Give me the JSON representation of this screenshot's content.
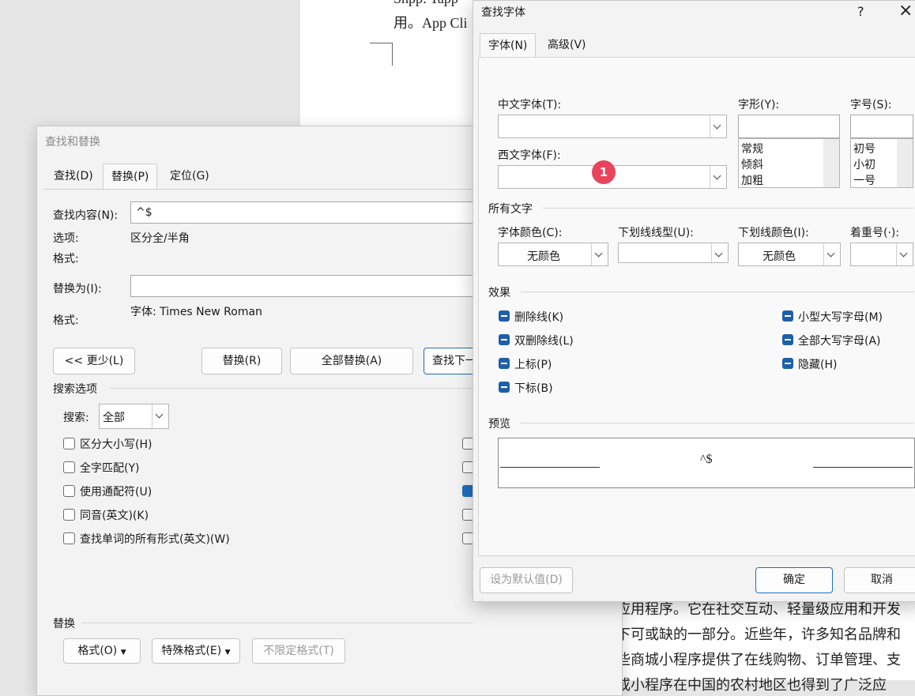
{
  "document": {
    "line_top": "Snpp: Tapp",
    "line_partial": "用。App Cli",
    "lines_bottom": [
      "应用程序。它在社交互动、轻量级应用和开发",
      "下可或缺的一部分。近些年，许多知名品牌和",
      "些商城小程序提供了在线购物、订单管理、支",
      "或小程序在中国的农村地区也得到了广泛应"
    ]
  },
  "find_replace": {
    "title": "查找和替换",
    "tabs": [
      "查找(D)",
      "替换(P)",
      "定位(G)"
    ],
    "active_tab": "替换(P)",
    "find_label": "查找内容(N):",
    "find_value": "^$",
    "options_label": "选项:",
    "options_value": "区分全/半角",
    "format_label_1": "格式:",
    "replace_label": "替换为(I):",
    "replace_value": "",
    "format_label_2": "格式:",
    "format_value_2": "字体: Times New Roman",
    "buttons": {
      "less": "<< 更少(L)",
      "replace": "替换(R)",
      "replace_all": "全部替换(A)",
      "find_next": "查找下一"
    },
    "search_options_title": "搜索选项",
    "search_label": "搜索:",
    "search_value": "全部",
    "checkboxes": [
      {
        "label": "区分大小写(H)",
        "checked": false
      },
      {
        "label": "全字匹配(Y)",
        "checked": false
      },
      {
        "label": "使用通配符(U)",
        "checked": false
      },
      {
        "label": "同音(英文)(K)",
        "checked": false
      },
      {
        "label": "查找单词的所有形式(英文)(W)",
        "checked": false
      }
    ],
    "right_checkboxes_checked": [
      false,
      false,
      true,
      false,
      false
    ],
    "replace_section_title": "替换",
    "bottom_buttons": {
      "format": "格式(O)",
      "special": "特殊格式(E)",
      "no_format": "不限定格式(T)"
    }
  },
  "find_font": {
    "title": "查找字体",
    "help_icon": "?",
    "close_icon": "×",
    "tabs": [
      "字体(N)",
      "高级(V)"
    ],
    "active_tab": "字体(N)",
    "chinese_font_label": "中文字体(T):",
    "western_font_label": "西文字体(F):",
    "style_label": "字形(Y):",
    "style_options": [
      "常规",
      "倾斜",
      "加粗"
    ],
    "size_label": "字号(S):",
    "size_options": [
      "初号",
      "小初",
      "一号"
    ],
    "badge": "1",
    "all_text_title": "所有文字",
    "font_color_label": "字体颜色(C):",
    "font_color_value": "无颜色",
    "underline_style_label": "下划线线型(U):",
    "underline_color_label": "下划线颜色(I):",
    "underline_color_value": "无颜色",
    "emphasis_label": "着重号(·):",
    "effects_title": "效果",
    "effects_left": [
      "删除线(K)",
      "双删除线(L)",
      "上标(P)",
      "下标(B)"
    ],
    "effects_right": [
      "小型大写字母(M)",
      "全部大写字母(A)",
      "隐藏(H)"
    ],
    "preview_title": "预览",
    "preview_text": "^$",
    "set_default": "设为默认值(D)",
    "ok": "确定",
    "cancel": "取消",
    "accent_color": "#1f5fa8",
    "badge_color": "#e8455c"
  }
}
